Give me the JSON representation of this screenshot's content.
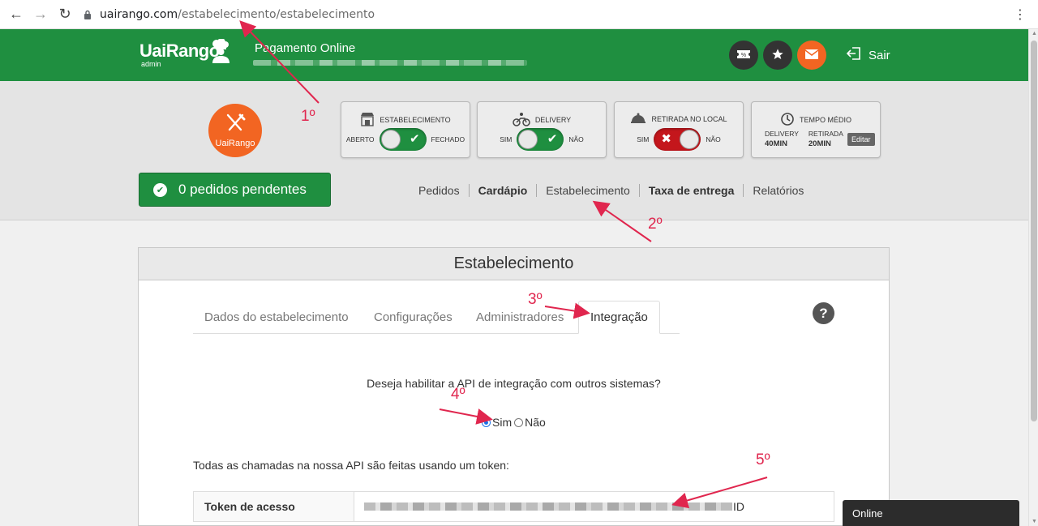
{
  "browser": {
    "back": "←",
    "forward": "→",
    "reload": "↻",
    "url_domain": "uairango.com",
    "url_path": "/estabelecimento/estabelecimento",
    "menu": "⋮"
  },
  "header": {
    "logo_main": "UaiRango",
    "logo_sub": "admin",
    "title": "Pagamento Online",
    "logout_label": "Sair",
    "icons": [
      "coupon-icon",
      "star-icon",
      "mail-icon"
    ],
    "brand_color": "#1f8f40",
    "accent_color": "#f26522"
  },
  "brand": {
    "logo_text": "UaiRango"
  },
  "status_cards": {
    "estabelecimento": {
      "title": "ESTABELECIMENTO",
      "left": "ABERTO",
      "right": "FECHADO",
      "state": "on"
    },
    "delivery": {
      "title": "DELIVERY",
      "left": "SIM",
      "right": "NÃO",
      "state": "on"
    },
    "retirada": {
      "title": "RETIRADA NO LOCAL",
      "left": "SIM",
      "right": "NÃO",
      "state": "off"
    },
    "tempo": {
      "title": "TEMPO MÉDIO",
      "delivery_label": "DELIVERY",
      "delivery_value": "40MIN",
      "retirada_label": "RETIRADA",
      "retirada_value": "20MIN",
      "edit_label": "Editar"
    }
  },
  "pending_button": "0 pedidos pendentes",
  "menu": {
    "items": [
      "Pedidos",
      "Cardápio",
      "Estabelecimento",
      "Taxa de entrega",
      "Relatórios"
    ]
  },
  "panel": {
    "title": "Estabelecimento",
    "tabs": [
      "Dados do estabelecimento",
      "Configurações",
      "Administradores",
      "Integração"
    ],
    "active_tab": "Integração",
    "help": "?",
    "question": "Deseja habilitar a API de integração com outros sistemas?",
    "radio_yes": "Sim",
    "radio_no": "Não",
    "selected": "Sim",
    "token_text": "Todas as chamadas na nossa API são feitas usando um token:",
    "token_label": "Token de acesso",
    "token_suffix": "ID"
  },
  "online_bar": "Online",
  "annotations": {
    "color": "#e0264e",
    "steps": [
      "1º",
      "2º",
      "3º",
      "4º",
      "5º"
    ]
  }
}
